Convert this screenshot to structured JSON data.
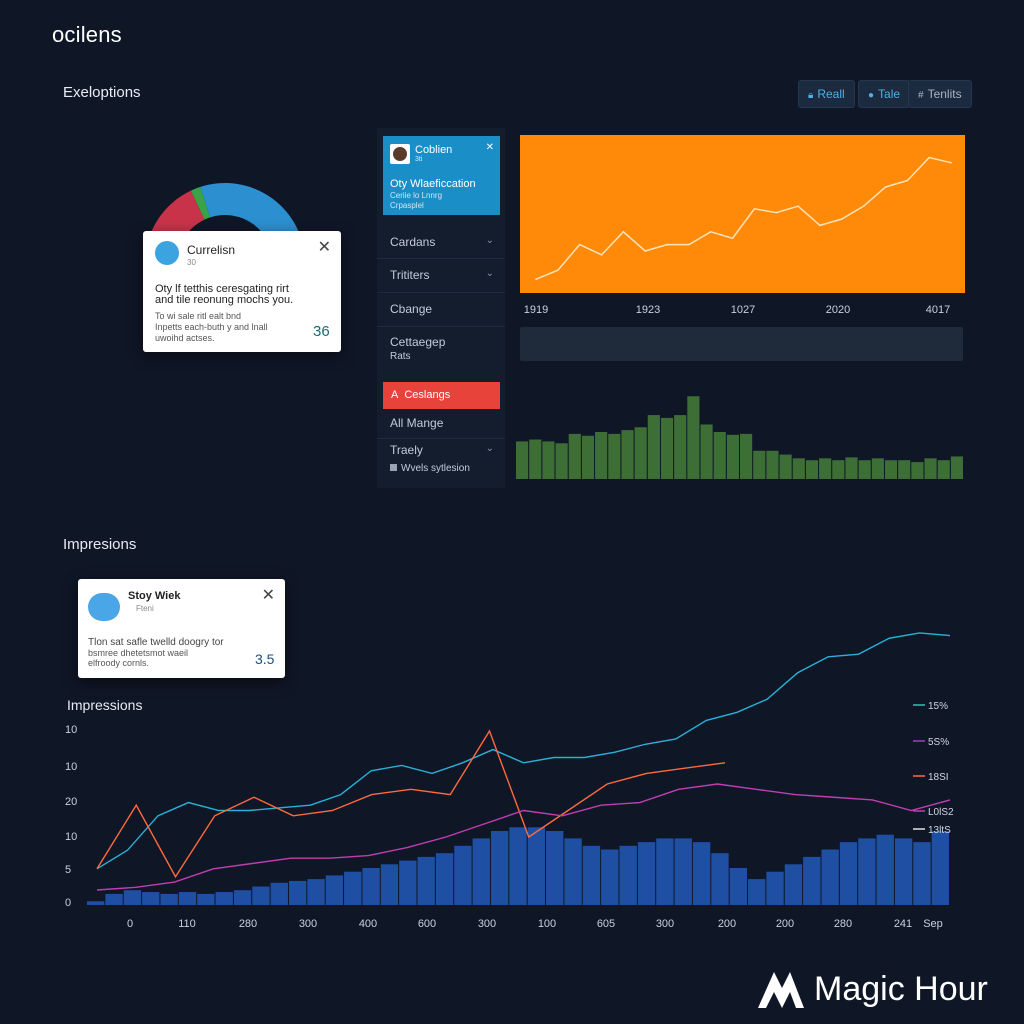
{
  "app": {
    "title": "ocilens"
  },
  "section1": {
    "title": "Exeloptions"
  },
  "toolbar": [
    {
      "icon": "lock-icon",
      "label": "Reall"
    },
    {
      "icon": "dot-icon",
      "label": "Tale"
    },
    {
      "icon": "hash-icon",
      "label": "Tenlits"
    }
  ],
  "popup1": {
    "title": "Currelisn",
    "sub": "30",
    "line1": "Oty lf tetthis ceresgating rirt",
    "line2": "and tile reonung mochs you.",
    "line3": "To wi sale ritl ealt bnd",
    "line4": "Inpetts each-buth y and lnall",
    "line5": "uwoihd actses.",
    "value": "36"
  },
  "notice": {
    "title": "Coblien",
    "sub": "3ti",
    "line1": "Oty Wlaeficcation",
    "line2": "Ceriie lo Lnnrg",
    "line3": "Crpasplel"
  },
  "sidebar": {
    "items": [
      {
        "label": "Cardans",
        "chevron": "⌄"
      },
      {
        "label": "Trititers",
        "chevron": "⌄"
      },
      {
        "label": "Cbange"
      },
      {
        "label": "Cettaegep",
        "sub": "Rats"
      },
      {
        "label": "Ceslangs",
        "prefix": "A"
      },
      {
        "label": "All Mange"
      },
      {
        "label": "Traely",
        "chevron": "⌄",
        "sub": "Wvels sytlesion"
      }
    ]
  },
  "section2": {
    "title": "Impresions"
  },
  "popup2": {
    "title": "Stoy Wiek",
    "sub": "Fteni",
    "line1": "Tlon sat safle twelld doogry tor",
    "line2": "bsmree dhetetsmot waeil",
    "line3": "elfroody cornls.",
    "value": "3.5"
  },
  "chart_area_title": "Impressions",
  "legend": [
    {
      "label": "15%",
      "color": "#2ec4b6"
    },
    {
      "label": "5S%",
      "color": "#9b3fbf"
    },
    {
      "label": "18SI",
      "color": "#ff6a3d"
    },
    {
      "label": "L0lS2",
      "color": "#c03fb0"
    },
    {
      "label": "13ltS",
      "color": "#e2e2e2"
    }
  ],
  "watermark": {
    "label": "Magic Hour"
  },
  "colors": {
    "orange": "#ff8a0a",
    "green": "#3d6e35",
    "blue_bars": "#1e4fa3",
    "cyan": "#2ab0d8",
    "accent_red": "#e8433a"
  },
  "chart_data": [
    {
      "type": "pie",
      "title": "",
      "slices": [
        {
          "label": "",
          "value": 36,
          "color": "#c8334a"
        },
        {
          "label": "",
          "value": 4,
          "color": "#3aa347"
        },
        {
          "label": "",
          "value": 60,
          "color": "#2b8fd0"
        }
      ],
      "note": "half-donut partially covered by popup"
    },
    {
      "type": "area",
      "title": "",
      "x_ticks": [
        "1919",
        "1923",
        "1027",
        "2020",
        "4017"
      ],
      "values": [
        0.03,
        0.1,
        0.3,
        0.22,
        0.4,
        0.25,
        0.3,
        0.3,
        0.4,
        0.35,
        0.58,
        0.55,
        0.6,
        0.45,
        0.5,
        0.6,
        0.75,
        0.8,
        0.98,
        0.94
      ],
      "background": "#ff8a0a",
      "line_color": "#ffe2b8"
    },
    {
      "type": "bar",
      "title": "",
      "values": [
        40,
        42,
        40,
        38,
        48,
        46,
        50,
        48,
        52,
        55,
        68,
        65,
        68,
        88,
        58,
        50,
        47,
        48,
        30,
        30,
        26,
        22,
        20,
        22,
        20,
        23,
        20,
        22,
        20,
        20,
        18,
        22,
        20,
        24
      ],
      "color": "#3d6e35"
    },
    {
      "type": "line",
      "title": "Impressions",
      "y_ticks": [
        "10",
        "10",
        "20",
        "10",
        "5",
        "0"
      ],
      "x_ticks": [
        "0",
        "110",
        "280",
        "300",
        "400",
        "600",
        "300",
        "100",
        "605",
        "300",
        "200",
        "200",
        "280",
        "241",
        "Sep"
      ],
      "legend": [
        "15%",
        "5S%",
        "18SI",
        "L0lS2",
        "13ltS"
      ],
      "series": [
        {
          "name": "",
          "color": "#2ab0d8",
          "values": [
            0.08,
            0.15,
            0.28,
            0.33,
            0.3,
            0.3,
            0.31,
            0.32,
            0.36,
            0.45,
            0.47,
            0.44,
            0.48,
            0.53,
            0.48,
            0.5,
            0.5,
            0.52,
            0.55,
            0.57,
            0.64,
            0.67,
            0.72,
            0.82,
            0.88,
            0.89,
            0.95,
            0.97,
            0.96
          ]
        },
        {
          "name": "",
          "color": "#ff6a3d",
          "values": [
            0.08,
            0.32,
            0.05,
            0.28,
            0.35,
            0.28,
            0.3,
            0.36,
            0.38,
            0.36,
            0.6,
            0.2,
            0.3,
            0.4,
            0.44,
            0.46,
            0.48
          ]
        },
        {
          "name": "",
          "color": "#c03fb0",
          "values": [
            0.0,
            0.01,
            0.03,
            0.08,
            0.1,
            0.12,
            0.12,
            0.13,
            0.16,
            0.2,
            0.25,
            0.3,
            0.28,
            0.32,
            0.33,
            0.38,
            0.4,
            0.38,
            0.36,
            0.35,
            0.34,
            0.3,
            0.34
          ]
        }
      ],
      "bars": {
        "color": "#1e4fa3",
        "values": [
          0.02,
          0.06,
          0.08,
          0.07,
          0.06,
          0.07,
          0.06,
          0.07,
          0.08,
          0.1,
          0.12,
          0.13,
          0.14,
          0.16,
          0.18,
          0.2,
          0.22,
          0.24,
          0.26,
          0.28,
          0.32,
          0.36,
          0.4,
          0.42,
          0.42,
          0.4,
          0.36,
          0.32,
          0.3,
          0.32,
          0.34,
          0.36,
          0.36,
          0.34,
          0.28,
          0.2,
          0.14,
          0.18,
          0.22,
          0.26,
          0.3,
          0.34,
          0.36,
          0.38,
          0.36,
          0.34,
          0.4
        ]
      }
    }
  ]
}
